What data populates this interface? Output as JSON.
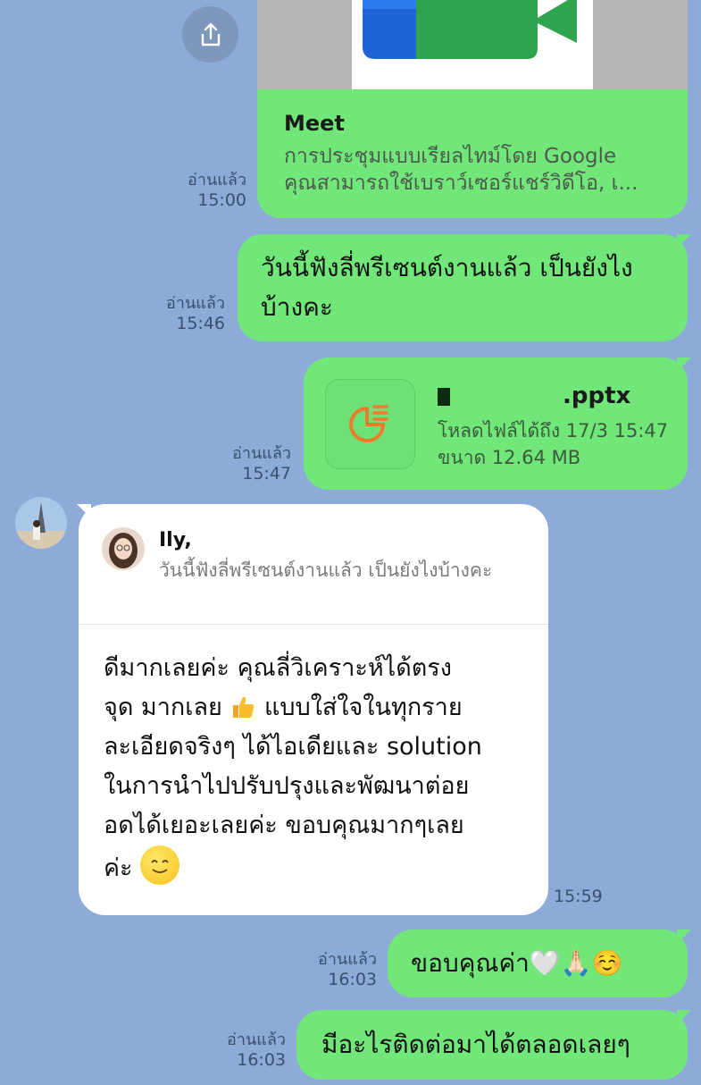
{
  "colors": {
    "background": "#8cabd9",
    "sent_bubble": "#71e77a",
    "received_bubble": "#ffffff"
  },
  "share_button": {
    "icon": "share-upload-icon"
  },
  "messages": [
    {
      "type": "link-preview",
      "title": "Meet",
      "description_line1": "การประชุมแบบเรียลไทม์โดย Google",
      "description_line2": "คุณสามารถใช้เบราว์เซอร์แชร์วิดีโอ, เ...",
      "read_label": "อ่านแล้ว",
      "time": "15:00"
    },
    {
      "type": "text",
      "line1": "วันนี้ฟังลี่พรีเซนต์งานแล้ว เป็นยังไง",
      "line2": "บ้างคะ",
      "read_label": "อ่านแล้ว",
      "time": "15:46"
    },
    {
      "type": "file",
      "icon": "presentation-file-icon",
      "file_name": ".pptx",
      "download_until": "โหลดไฟล์ได้ถึง 17/3 15:47",
      "size": "ขนาด 12.64 MB",
      "read_label": "อ่านแล้ว",
      "time": "15:47"
    },
    {
      "type": "reply",
      "quote_name": "Ily,",
      "quote_text": "วันนี้ฟังลี่พรีเซนต์งานแล้ว เป็นยังไงบ้างคะ",
      "lines": [
        "ดีมากเลยค่ะ คุณลี่วิเคราะห์ได้ตรง",
        "จุด มากเลย",
        "แบบใส่ใจในทุกราย",
        "ละเอียดจริงๆ ได้ไอเดียและ solution",
        "ในการนำไปปรับปรุงและพัฒนาต่อย",
        "อดได้เยอะเลยค่ะ ขอบคุณมากๆเลย",
        "ค่ะ"
      ],
      "time": "15:59"
    },
    {
      "type": "text",
      "text": "ขอบคุณค่า",
      "emojis": "🤍🙏🏻☺️",
      "read_label": "อ่านแล้ว",
      "time": "16:03"
    },
    {
      "type": "text",
      "text": "มีอะไรติดต่อมาได้ตลอดเลยๆ",
      "read_label": "อ่านแล้ว",
      "time": "16:03"
    }
  ]
}
